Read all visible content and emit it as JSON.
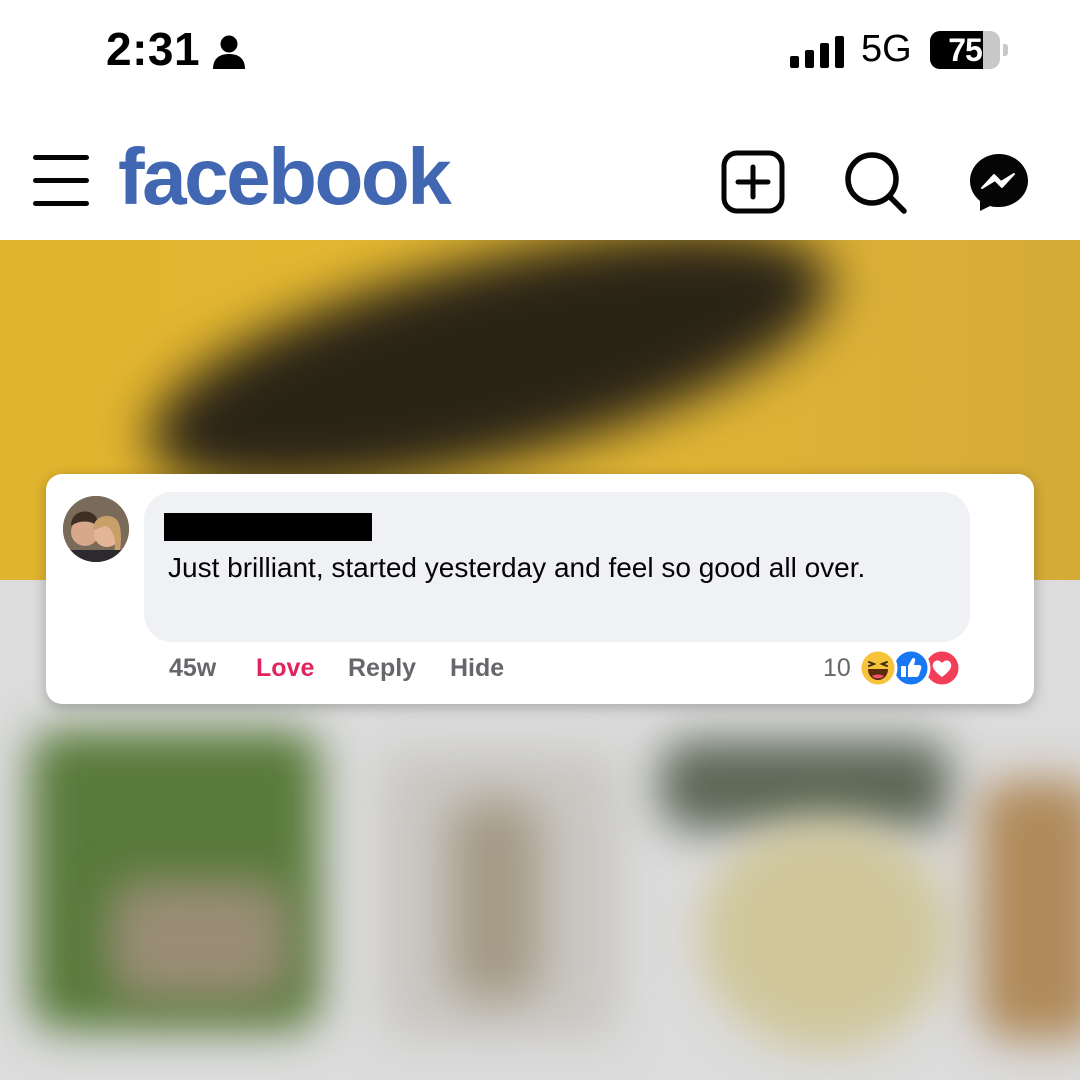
{
  "status_bar": {
    "time": "2:31",
    "network": "5G",
    "battery_percent": "75",
    "battery_level": 0.75
  },
  "nav": {
    "logo_text": "facebook",
    "icons": [
      "menu-icon",
      "create-post-icon",
      "search-icon",
      "messenger-icon"
    ],
    "brand_color": "#4267b2"
  },
  "comment": {
    "text": "Just brilliant, started yesterday and feel so good all over.",
    "time_ago": "45w",
    "love_label": "Love",
    "reply_label": "Reply",
    "hide_label": "Hide",
    "reaction_count": "10",
    "reactions": [
      "haha",
      "like",
      "love"
    ],
    "colors": {
      "love_active": "#e0245e",
      "action_gray": "#65676b",
      "bubble_bg": "#f0f1f5"
    }
  }
}
